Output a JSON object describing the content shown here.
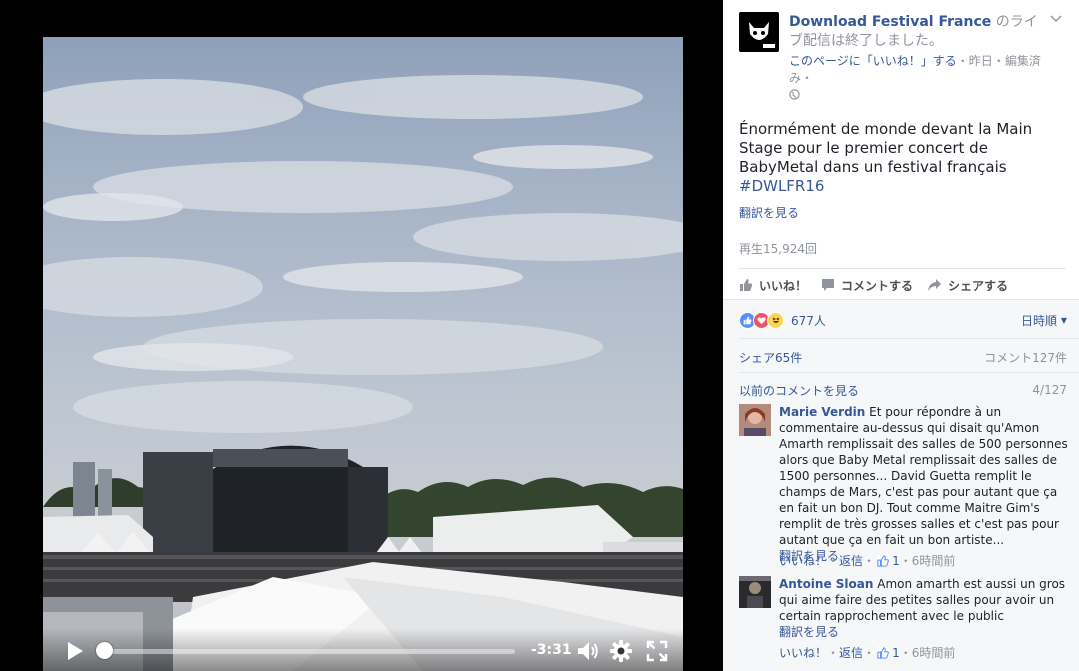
{
  "video": {
    "time_remaining": "-3:31",
    "progress": 0.0,
    "controls": {
      "play_icon": "play-icon",
      "volume_icon": "volume-icon",
      "settings_icon": "gear-icon",
      "fullscreen_icon": "fullscreen-icon"
    }
  },
  "post": {
    "page_name": "Download Festival France",
    "live_status": "のライブ配信は終了しました。",
    "like_page": "このページに「いいね！」する",
    "meta_sep1": "・",
    "date": "昨日",
    "meta_sep2": "・",
    "edited": "編集済み",
    "meta_sep3": "・",
    "privacy_icon": "globe-icon",
    "text": "Énormément de monde devant la Main Stage pour le premier concert de BabyMetal dans un festival français",
    "hashtag": "#DWLFR16",
    "translate": "翻訳を見る",
    "views": "再生15,924回"
  },
  "actions": {
    "like": "いいね！",
    "comment": "コメントする",
    "share": "シェアする"
  },
  "stats": {
    "reactions": [
      "like",
      "love",
      "haha"
    ],
    "reaction_count": "677人",
    "sort": "日時順",
    "shares": "シェア65件",
    "comments": "コメント127件",
    "previous_comments": "以前のコメントを見る",
    "pager": "4/127"
  },
  "comments": [
    {
      "author": "Marie Verdin",
      "text": "Et pour répondre à un commentaire au-dessus qui disait qu'Amon Amarth remplissait des salles de 500 personnes alors que Baby Metal remplissait des salles de 1500 personnes... David Guetta remplit le champs de Mars, c'est pas pour autant que ça en fait un bon DJ. Tout comme Maitre Gim's remplit de très grosses salles et c'est pas pour autant que ça en fait un bon artiste...",
      "translate": "翻訳を見る",
      "like": "いいね！",
      "sep1": "・",
      "reply": "返信",
      "sep2": "・",
      "likes": "1",
      "sep3": "・",
      "time": "6時間前"
    },
    {
      "author": "Antoine Sloan",
      "text": "Amon amarth est aussi un gros qui aime faire des petites salles pour avoir un certain rapprochement avec le public",
      "translate": "翻訳を見る",
      "like": "いいね！",
      "sep1": "・",
      "reply": "返信",
      "sep2": "・",
      "likes": "1",
      "sep3": "・",
      "time": "6時間前"
    }
  ],
  "colors": {
    "link": "#365899",
    "muted": "#90949c",
    "like_blue": "#5890ff",
    "love_red": "#f25268",
    "haha_yellow": "#ffd454"
  }
}
